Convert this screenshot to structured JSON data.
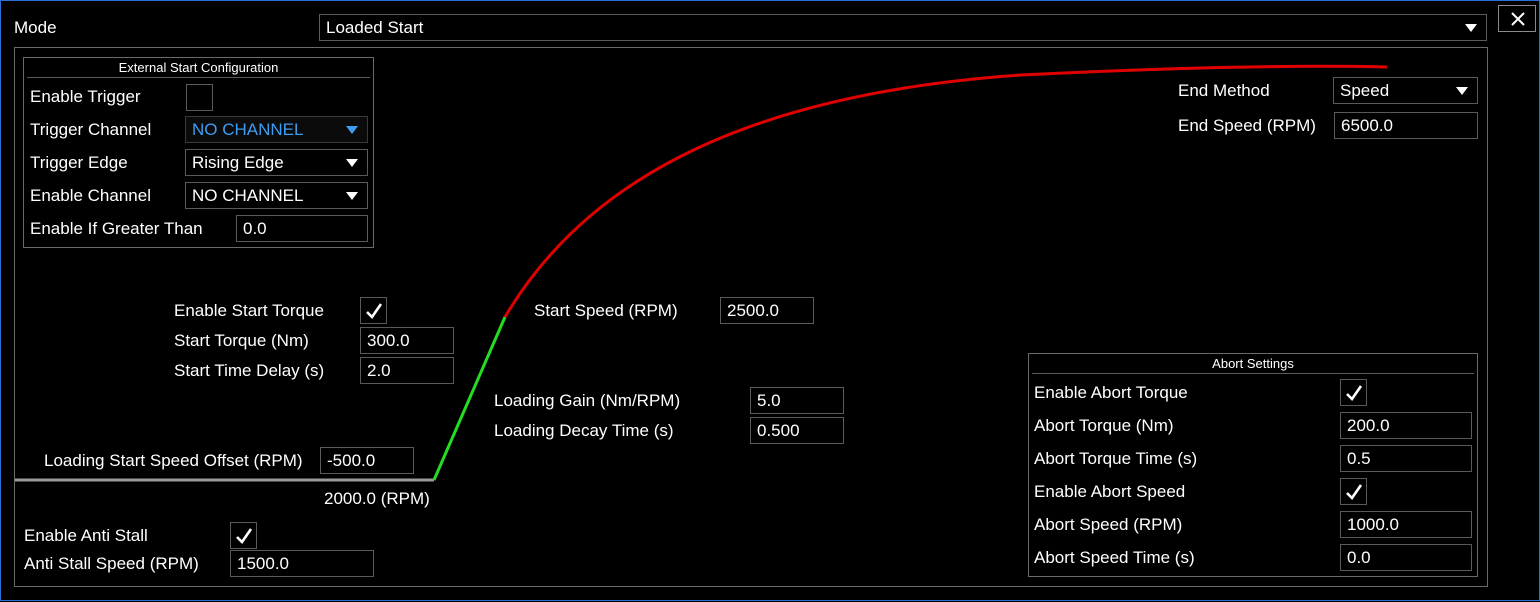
{
  "mode": {
    "label": "Mode",
    "value": "Loaded Start"
  },
  "external_start": {
    "title": "External Start Configuration",
    "enable_trigger_label": "Enable Trigger",
    "enable_trigger_checked": false,
    "trigger_channel_label": "Trigger Channel",
    "trigger_channel_value": "NO CHANNEL",
    "trigger_edge_label": "Trigger Edge",
    "trigger_edge_value": "Rising Edge",
    "enable_channel_label": "Enable Channel",
    "enable_channel_value": "NO CHANNEL",
    "enable_if_greater_label": "Enable If Greater Than",
    "enable_if_greater_value": "0.0"
  },
  "start": {
    "enable_start_torque_label": "Enable Start Torque",
    "enable_start_torque_checked": true,
    "start_torque_label": "Start Torque (Nm)",
    "start_torque_value": "300.0",
    "start_time_delay_label": "Start Time Delay (s)",
    "start_time_delay_value": "2.0",
    "start_speed_label": "Start Speed (RPM)",
    "start_speed_value": "2500.0"
  },
  "loading": {
    "gain_label": "Loading Gain (Nm/RPM)",
    "gain_value": "5.0",
    "decay_label": "Loading Decay Time (s)",
    "decay_value": "0.500",
    "offset_label": "Loading Start Speed Offset (RPM)",
    "offset_value": "-500.0",
    "base_speed_text": "2000.0 (RPM)"
  },
  "anti_stall": {
    "enable_label": "Enable Anti Stall",
    "enable_checked": true,
    "speed_label": "Anti Stall Speed (RPM)",
    "speed_value": "1500.0"
  },
  "end": {
    "method_label": "End Method",
    "method_value": "Speed",
    "speed_label": "End Speed (RPM)",
    "speed_value": "6500.0"
  },
  "abort": {
    "title": "Abort Settings",
    "enable_torque_label": "Enable Abort Torque",
    "enable_torque_checked": true,
    "torque_label": "Abort Torque (Nm)",
    "torque_value": "200.0",
    "torque_time_label": "Abort Torque Time (s)",
    "torque_time_value": "0.5",
    "enable_speed_label": "Enable Abort Speed",
    "enable_speed_checked": true,
    "speed_label": "Abort Speed (RPM)",
    "speed_value": "1000.0",
    "speed_time_label": "Abort Speed Time (s)",
    "speed_time_value": "0.0"
  },
  "colors": {
    "idle_line": "#9a9a9a",
    "ramp_line": "#22dd22",
    "load_curve": "#e00000",
    "accent": "#2b6fd6",
    "channel_text": "#3d9df0"
  }
}
